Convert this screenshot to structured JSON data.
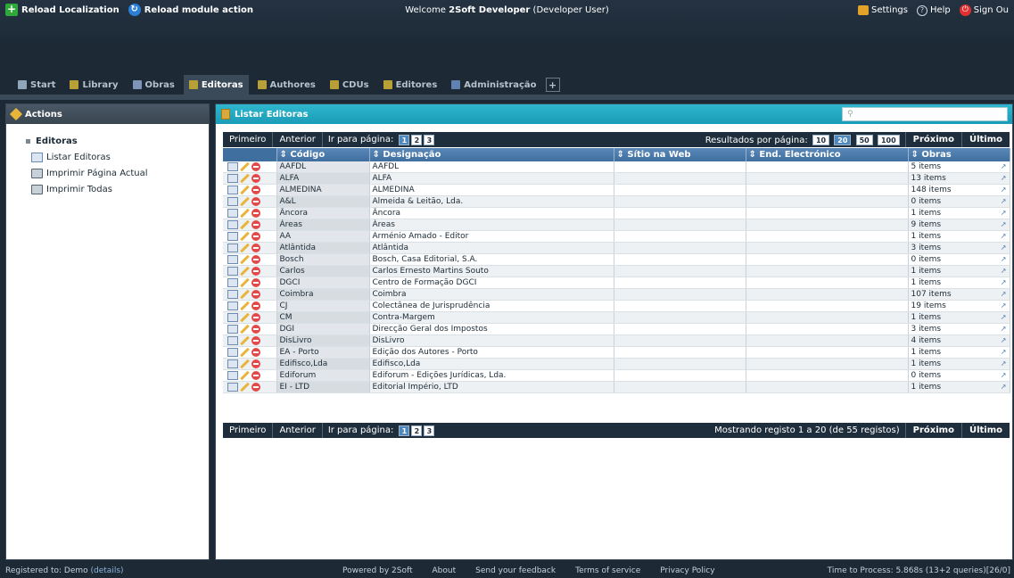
{
  "topbar": {
    "reload_localization": "Reload Localization",
    "reload_module": "Reload module action",
    "welcome_prefix": "Welcome",
    "welcome_name": "2Soft Developer",
    "welcome_suffix": "(Developer User)",
    "settings": "Settings",
    "help": "Help",
    "signout": "Sign Ou"
  },
  "tabs": [
    {
      "label": "Start",
      "icon": "home-icon"
    },
    {
      "label": "Library",
      "icon": "book-icon"
    },
    {
      "label": "Obras",
      "icon": "books-icon"
    },
    {
      "label": "Editoras",
      "icon": "book-icon",
      "active": true
    },
    {
      "label": "Authores",
      "icon": "book-icon"
    },
    {
      "label": "CDUs",
      "icon": "book-icon"
    },
    {
      "label": "Editores",
      "icon": "book-icon"
    },
    {
      "label": "Administração",
      "icon": "monitor-icon"
    }
  ],
  "left": {
    "title": "Actions",
    "node": "Editoras",
    "items": [
      "Listar Editoras",
      "Imprimir Página Actual",
      "Imprimir Todas"
    ]
  },
  "right": {
    "title": "Listar Editoras",
    "search_placeholder": "",
    "pager": {
      "first": "Primeiro",
      "prev": "Anterior",
      "goto": "Ir para página:",
      "pages": [
        "1",
        "2",
        "3"
      ],
      "results_label": "Resultados por página:",
      "sizes": [
        "10",
        "20",
        "50",
        "100"
      ],
      "next": "Próximo",
      "last": "Último",
      "status": "Mostrando registo 1 a 20 (de 55 registos)"
    },
    "columns": [
      "Código",
      "Designação",
      "Sítio na Web",
      "End. Electrónico",
      "Obras"
    ],
    "rows": [
      [
        "AAFDL",
        "AAFDL",
        "",
        "",
        "5 items"
      ],
      [
        "ALFA",
        "ALFA",
        "",
        "",
        "13 items"
      ],
      [
        "ALMEDINA",
        "ALMEDINA",
        "",
        "",
        "148 items"
      ],
      [
        "A&L",
        "Almeida & Leitão, Lda.",
        "",
        "",
        "0 items"
      ],
      [
        "Âncora",
        "Âncora",
        "",
        "",
        "1 items"
      ],
      [
        "Áreas",
        "Áreas",
        "",
        "",
        "9 items"
      ],
      [
        "AA",
        "Arménio Amado - Editor",
        "",
        "",
        "1 items"
      ],
      [
        "Atlântida",
        "Atlântida",
        "",
        "",
        "3 items"
      ],
      [
        "Bosch",
        "Bosch, Casa Editorial, S.A.",
        "",
        "",
        "0 items"
      ],
      [
        "Carlos",
        "Carlos Ernesto Martins Souto",
        "",
        "",
        "1 items"
      ],
      [
        "DGCI",
        "Centro de Formação DGCI",
        "",
        "",
        "1 items"
      ],
      [
        "Coimbra",
        "Coimbra",
        "",
        "",
        "107 items"
      ],
      [
        "CJ",
        "Colectânea de Jurisprudência",
        "",
        "",
        "19 items"
      ],
      [
        "CM",
        "Contra-Margem",
        "",
        "",
        "1 items"
      ],
      [
        "DGI",
        "Direcção Geral dos Impostos",
        "",
        "",
        "3 items"
      ],
      [
        "DisLivro",
        "DisLivro",
        "",
        "",
        "4 items"
      ],
      [
        "EA - Porto",
        "Edição dos Autores - Porto",
        "",
        "",
        "1 items"
      ],
      [
        "Edifisco,Lda",
        "Edifisco,Lda",
        "",
        "",
        "1 items"
      ],
      [
        "Ediforum",
        "Ediforum - Edições Jurídicas, Lda.",
        "",
        "",
        "0 items"
      ],
      [
        "EI - LTD",
        "Editorial Império, LTD",
        "",
        "",
        "1 items"
      ]
    ]
  },
  "footer": {
    "registered": "Registered to: Demo",
    "details": "(details)",
    "links": [
      "Powered by 2Soft",
      "About",
      "Send your feedback",
      "Terms of service",
      "Privacy Policy"
    ],
    "time": "Time to Process: 5.868s (13+2 queries)[26/0]"
  }
}
